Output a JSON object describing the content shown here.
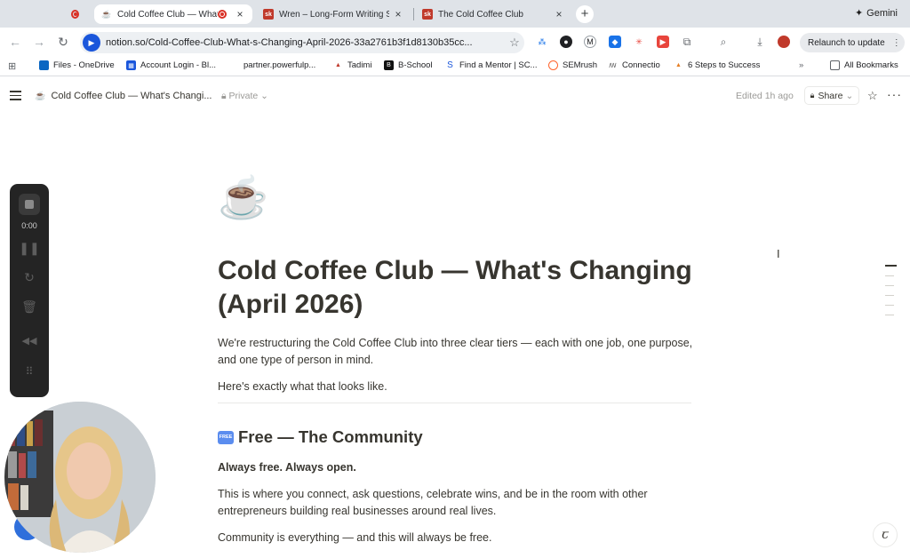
{
  "browser": {
    "tabs": [
      {
        "title": "",
        "recording": true
      },
      {
        "title": "Cold Coffee Club — What's",
        "icon": "coffee-icon",
        "recording": true
      },
      {
        "title": "Wren – Long-Form Writing Sp",
        "icon": "sk-icon"
      },
      {
        "title": "The Cold Coffee Club",
        "icon": "sk-icon"
      }
    ],
    "new_tab": "+",
    "gemini_label": "Gemini",
    "url": "notion.so/Cold-Coffee-Club-What-s-Changing-April-2026-33a2761b3f1d8130b35cc...",
    "relaunch_label": "Relaunch to update",
    "bookmarks": [
      {
        "label": "Files - OneDrive",
        "icon_color": "#0a66c2"
      },
      {
        "label": "Account Login - Bl...",
        "icon_color": "#1a56db"
      },
      {
        "label": "partner.powerfulp...",
        "icon_color": ""
      },
      {
        "label": "Tadimi",
        "icon_color": "#c0392b"
      },
      {
        "label": "B-School",
        "icon_color": "#111111"
      },
      {
        "label": "Find a Mentor | SC...",
        "icon_color": "#1a56db"
      },
      {
        "label": "SEMrush",
        "icon_color": "#ff642d"
      },
      {
        "label": "Connectio",
        "icon_color": "#555555"
      },
      {
        "label": "6 Steps to Success",
        "icon_color": "#e67e22"
      }
    ],
    "bookmarks_overflow": "»",
    "all_bookmarks": "All Bookmarks"
  },
  "notion": {
    "breadcrumb_title": "Cold Coffee Club — What's Changi...",
    "privacy": "Private",
    "edited": "Edited 1h ago",
    "share": "Share",
    "page_icon": "☕",
    "title": "Cold Coffee Club — What's Changing (April 2026)",
    "intro": "We're restructuring the Cold Coffee Club into three clear tiers — each with one job, one purpose, and one type of person in mind.",
    "lead": "Here's exactly what that looks like.",
    "section_badge": "FREE",
    "section_heading": "Free — The Community",
    "section_tagline": "Always free. Always open.",
    "section_body": "This is where you connect, ask questions, celebrate wins, and be in the room with other entrepreneurs building real businesses around real lives.",
    "section_closing": "Community is everything — and this will always be free."
  },
  "recorder": {
    "time": "0:00"
  }
}
